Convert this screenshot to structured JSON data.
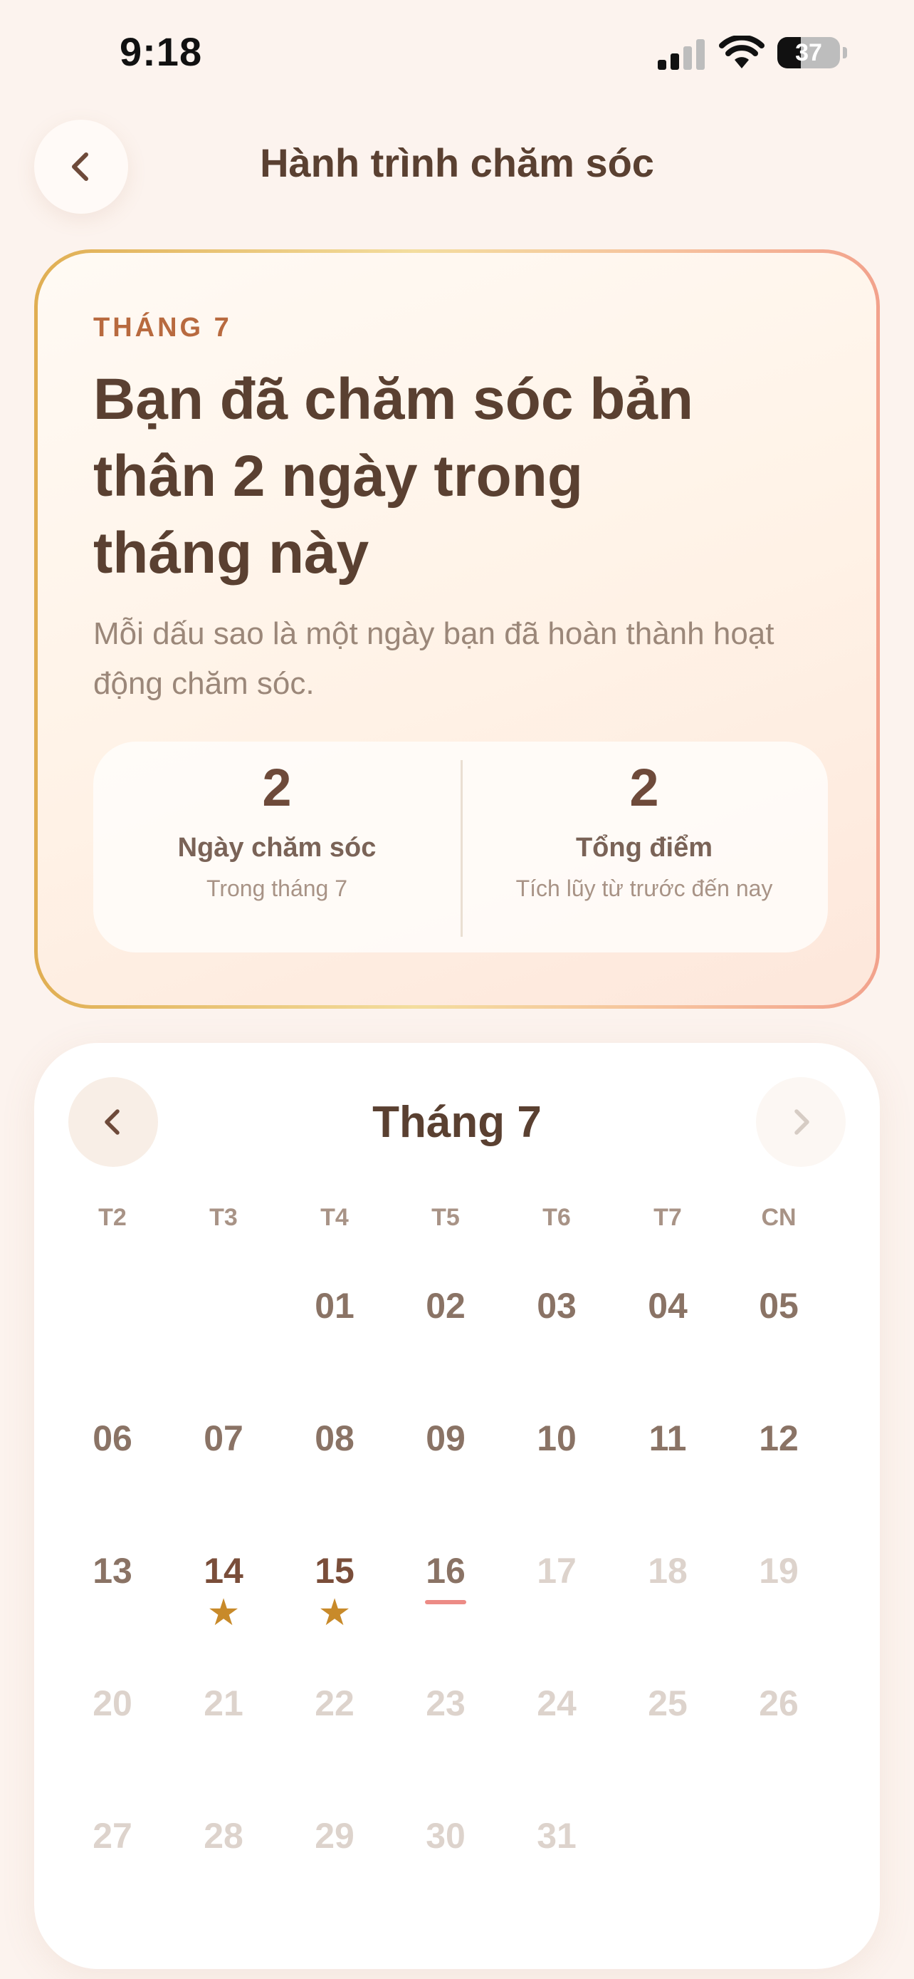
{
  "status_bar": {
    "time": "9:18",
    "battery_level": "37",
    "battery_fraction": 0.37
  },
  "header": {
    "back_icon": "chevron-left-icon",
    "title": "Hành trình chăm sóc"
  },
  "summary": {
    "month_label": "THÁNG 7",
    "headline": "Bạn đã chăm sóc bản thân 2 ngày trong tháng này",
    "subtext": "Mỗi dấu sao là một ngày bạn đã hoàn thành hoạt động chăm sóc.",
    "stats": [
      {
        "value": "2",
        "label": "Ngày chăm sóc",
        "sub": "Trong tháng 7"
      },
      {
        "value": "2",
        "label": "Tổng điểm",
        "sub": "Tích lũy từ trước đến nay"
      }
    ]
  },
  "calendar": {
    "title": "Tháng 7",
    "prev_icon": "chevron-left-icon",
    "next_icon": "chevron-right-icon",
    "weekdays": [
      "T2",
      "T3",
      "T4",
      "T5",
      "T6",
      "T7",
      "CN"
    ],
    "star_glyph": "★",
    "rows": [
      [
        {
          "day": ""
        },
        {
          "day": ""
        },
        {
          "day": "01",
          "state": "past"
        },
        {
          "day": "02",
          "state": "past"
        },
        {
          "day": "03",
          "state": "past"
        },
        {
          "day": "04",
          "state": "past"
        },
        {
          "day": "05",
          "state": "past"
        }
      ],
      [
        {
          "day": "06",
          "state": "past"
        },
        {
          "day": "07",
          "state": "past"
        },
        {
          "day": "08",
          "state": "past"
        },
        {
          "day": "09",
          "state": "past"
        },
        {
          "day": "10",
          "state": "past"
        },
        {
          "day": "11",
          "state": "past"
        },
        {
          "day": "12",
          "state": "past"
        }
      ],
      [
        {
          "day": "13",
          "state": "past"
        },
        {
          "day": "14",
          "state": "done",
          "star": true
        },
        {
          "day": "15",
          "state": "done",
          "star": true
        },
        {
          "day": "16",
          "state": "today"
        },
        {
          "day": "17",
          "state": "future"
        },
        {
          "day": "18",
          "state": "future"
        },
        {
          "day": "19",
          "state": "future"
        }
      ],
      [
        {
          "day": "20",
          "state": "future"
        },
        {
          "day": "21",
          "state": "future"
        },
        {
          "day": "22",
          "state": "future"
        },
        {
          "day": "23",
          "state": "future"
        },
        {
          "day": "24",
          "state": "future"
        },
        {
          "day": "25",
          "state": "future"
        },
        {
          "day": "26",
          "state": "future"
        }
      ],
      [
        {
          "day": "27",
          "state": "future"
        },
        {
          "day": "28",
          "state": "future"
        },
        {
          "day": "29",
          "state": "future"
        },
        {
          "day": "30",
          "state": "future"
        },
        {
          "day": "31",
          "state": "future"
        },
        {
          "day": ""
        },
        {
          "day": ""
        }
      ]
    ]
  },
  "colors": {
    "text_primary": "#5a4031",
    "accent_orange": "#b86a3f",
    "star_gold": "#c88a2a",
    "today_underline": "#ec8b85"
  }
}
